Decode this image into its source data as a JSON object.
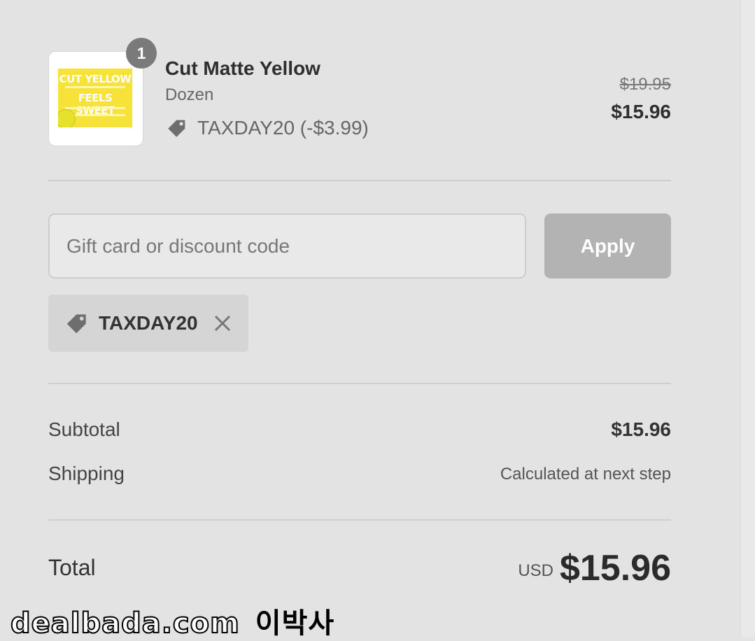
{
  "product": {
    "quantity": "1",
    "name": "Cut Matte Yellow",
    "variant": "Dozen",
    "discount_line": "TAXDAY20 (-$3.99)",
    "original_price": "$19.95",
    "price": "$15.96",
    "thumbnail_text": {
      "line1": "CUT YELLOW",
      "line2": "FEELS SWEET"
    }
  },
  "discount": {
    "input_placeholder": "Gift card or discount code",
    "input_value": "",
    "apply_label": "Apply",
    "applied_code": "TAXDAY20"
  },
  "summary": {
    "subtotal_label": "Subtotal",
    "subtotal_value": "$15.96",
    "shipping_label": "Shipping",
    "shipping_value": "Calculated at next step",
    "total_label": "Total",
    "currency": "USD",
    "total_value": "$15.96"
  },
  "watermark": {
    "site": "dealbada.com",
    "author": "이박사"
  },
  "icons": {
    "tag": "tag-icon",
    "remove": "close-icon"
  },
  "colors": {
    "background": "#e3e3e3",
    "apply_button": "#b3b3b3",
    "chip": "#d5d5d5",
    "badge": "#7a7a7a",
    "thumbnail_card": "#f7e23a"
  }
}
